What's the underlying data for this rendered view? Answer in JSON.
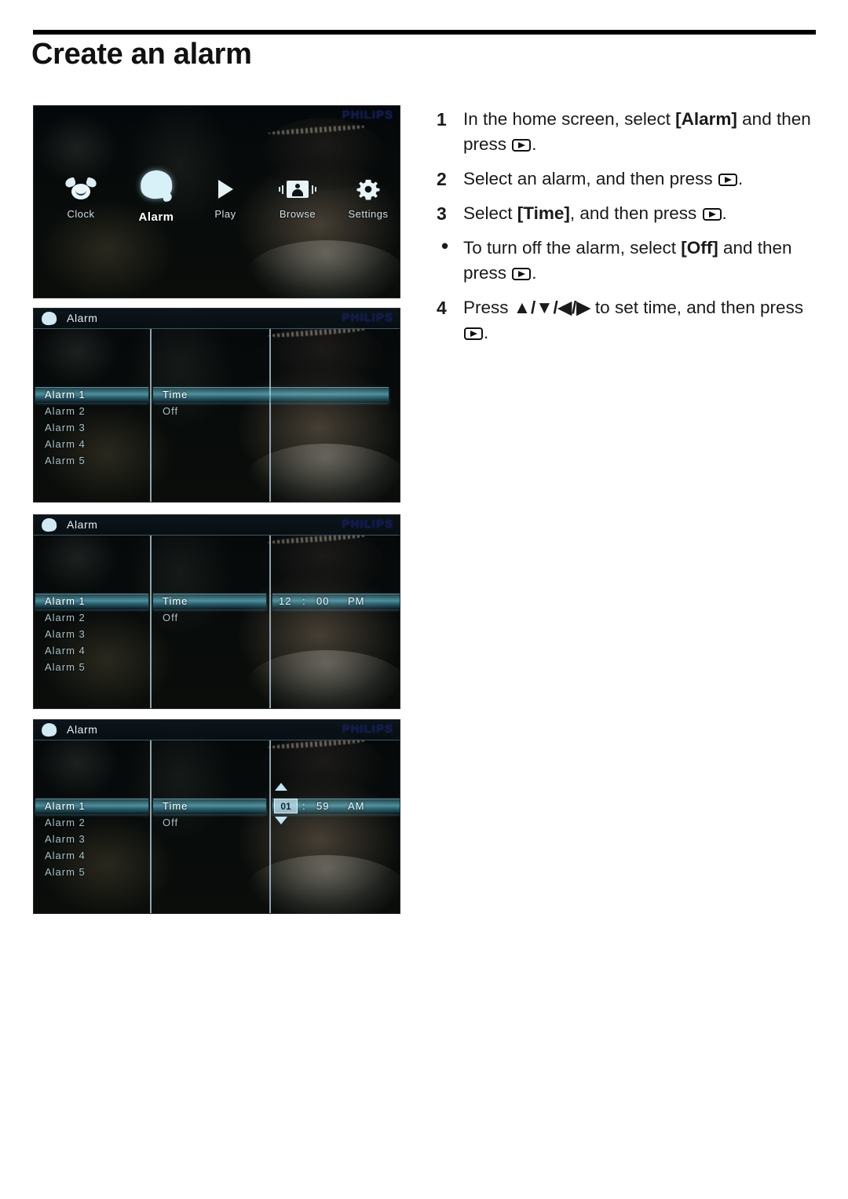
{
  "page": {
    "title": "Create an alarm"
  },
  "instructions": [
    {
      "marker": "1",
      "parts": [
        {
          "t": "In the home screen, select ",
          "b": false
        },
        {
          "t": "[Alarm]",
          "b": true
        },
        {
          "t": " and then press ",
          "b": false
        },
        {
          "t": "play-key",
          "icon": true
        },
        {
          "t": ".",
          "b": false
        }
      ]
    },
    {
      "marker": "2",
      "parts": [
        {
          "t": "Select an alarm, and then press ",
          "b": false
        },
        {
          "t": "play-key",
          "icon": true
        },
        {
          "t": ".",
          "b": false
        }
      ]
    },
    {
      "marker": "3",
      "parts": [
        {
          "t": "Select ",
          "b": false
        },
        {
          "t": "[Time]",
          "b": true
        },
        {
          "t": ", and then press ",
          "b": false
        },
        {
          "t": "play-key",
          "icon": true
        },
        {
          "t": ".",
          "b": false
        }
      ]
    },
    {
      "marker": "•",
      "bullet": true,
      "parts": [
        {
          "t": "To turn off the alarm, select ",
          "b": false
        },
        {
          "t": "[Off]",
          "b": true
        },
        {
          "t": " and then press ",
          "b": false
        },
        {
          "t": "play-key",
          "icon": true
        },
        {
          "t": ".",
          "b": false
        }
      ]
    },
    {
      "marker": "4",
      "parts": [
        {
          "t": "Press ",
          "b": false
        },
        {
          "t": "▲/▼/◀/▶",
          "b": true
        },
        {
          "t": " to set time, and then press ",
          "b": false
        },
        {
          "t": "play-key",
          "icon": true
        },
        {
          "t": ".",
          "b": false
        }
      ]
    }
  ],
  "screens": {
    "home": {
      "brand": "PHILIPS",
      "items": [
        {
          "label": "Clock",
          "icon": "clock-icon",
          "selected": false
        },
        {
          "label": "Alarm",
          "icon": "alarm-icon",
          "selected": true
        },
        {
          "label": "Play",
          "icon": "play-icon",
          "selected": false
        },
        {
          "label": "Browse",
          "icon": "browse-icon",
          "selected": false
        },
        {
          "label": "Settings",
          "icon": "settings-gear-icon",
          "selected": false
        }
      ]
    },
    "alarm_list": {
      "brand": "PHILIPS",
      "header_title": "Alarm",
      "alarms": [
        "Alarm 1",
        "Alarm 2",
        "Alarm 3",
        "Alarm 4",
        "Alarm 5"
      ],
      "selected_alarm": "Alarm 1",
      "options": [
        "Time",
        "Off"
      ],
      "selected_option": "Time",
      "time_value": ""
    },
    "alarm_time": {
      "brand": "PHILIPS",
      "header_title": "Alarm",
      "alarms": [
        "Alarm 1",
        "Alarm 2",
        "Alarm 3",
        "Alarm 4",
        "Alarm 5"
      ],
      "selected_alarm": "Alarm 1",
      "options": [
        "Time",
        "Off"
      ],
      "selected_option": "Time",
      "time_hour": "12",
      "time_sep": ":",
      "time_minute": "00",
      "time_meridiem": "PM"
    },
    "alarm_edit": {
      "brand": "PHILIPS",
      "header_title": "Alarm",
      "alarms": [
        "Alarm 1",
        "Alarm 2",
        "Alarm 3",
        "Alarm 4",
        "Alarm 5"
      ],
      "selected_alarm": "Alarm 1",
      "options": [
        "Time",
        "Off"
      ],
      "selected_option": "Time",
      "time_hour": "01",
      "time_sep": ":",
      "time_minute": "59",
      "time_meridiem": "AM"
    }
  },
  "colors": {
    "highlight_cyan": "#78e1f6",
    "brand_blue": "#131a52",
    "menu_text": "#a9c2c9",
    "screen_bg": "#05090a"
  }
}
